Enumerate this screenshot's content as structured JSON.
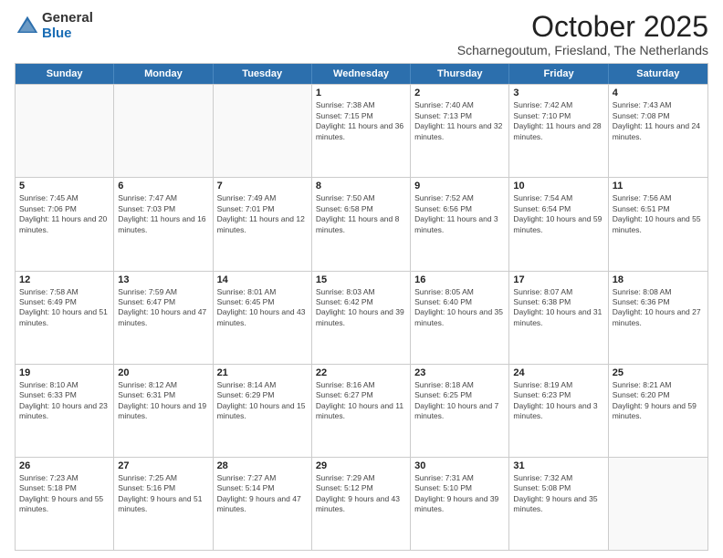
{
  "logo": {
    "general": "General",
    "blue": "Blue"
  },
  "title": "October 2025",
  "subtitle": "Scharnegoutum, Friesland, The Netherlands",
  "weekdays": [
    "Sunday",
    "Monday",
    "Tuesday",
    "Wednesday",
    "Thursday",
    "Friday",
    "Saturday"
  ],
  "weeks": [
    [
      {
        "day": "",
        "sunrise": "",
        "sunset": "",
        "daylight": ""
      },
      {
        "day": "",
        "sunrise": "",
        "sunset": "",
        "daylight": ""
      },
      {
        "day": "",
        "sunrise": "",
        "sunset": "",
        "daylight": ""
      },
      {
        "day": "1",
        "sunrise": "Sunrise: 7:38 AM",
        "sunset": "Sunset: 7:15 PM",
        "daylight": "Daylight: 11 hours and 36 minutes."
      },
      {
        "day": "2",
        "sunrise": "Sunrise: 7:40 AM",
        "sunset": "Sunset: 7:13 PM",
        "daylight": "Daylight: 11 hours and 32 minutes."
      },
      {
        "day": "3",
        "sunrise": "Sunrise: 7:42 AM",
        "sunset": "Sunset: 7:10 PM",
        "daylight": "Daylight: 11 hours and 28 minutes."
      },
      {
        "day": "4",
        "sunrise": "Sunrise: 7:43 AM",
        "sunset": "Sunset: 7:08 PM",
        "daylight": "Daylight: 11 hours and 24 minutes."
      }
    ],
    [
      {
        "day": "5",
        "sunrise": "Sunrise: 7:45 AM",
        "sunset": "Sunset: 7:06 PM",
        "daylight": "Daylight: 11 hours and 20 minutes."
      },
      {
        "day": "6",
        "sunrise": "Sunrise: 7:47 AM",
        "sunset": "Sunset: 7:03 PM",
        "daylight": "Daylight: 11 hours and 16 minutes."
      },
      {
        "day": "7",
        "sunrise": "Sunrise: 7:49 AM",
        "sunset": "Sunset: 7:01 PM",
        "daylight": "Daylight: 11 hours and 12 minutes."
      },
      {
        "day": "8",
        "sunrise": "Sunrise: 7:50 AM",
        "sunset": "Sunset: 6:58 PM",
        "daylight": "Daylight: 11 hours and 8 minutes."
      },
      {
        "day": "9",
        "sunrise": "Sunrise: 7:52 AM",
        "sunset": "Sunset: 6:56 PM",
        "daylight": "Daylight: 11 hours and 3 minutes."
      },
      {
        "day": "10",
        "sunrise": "Sunrise: 7:54 AM",
        "sunset": "Sunset: 6:54 PM",
        "daylight": "Daylight: 10 hours and 59 minutes."
      },
      {
        "day": "11",
        "sunrise": "Sunrise: 7:56 AM",
        "sunset": "Sunset: 6:51 PM",
        "daylight": "Daylight: 10 hours and 55 minutes."
      }
    ],
    [
      {
        "day": "12",
        "sunrise": "Sunrise: 7:58 AM",
        "sunset": "Sunset: 6:49 PM",
        "daylight": "Daylight: 10 hours and 51 minutes."
      },
      {
        "day": "13",
        "sunrise": "Sunrise: 7:59 AM",
        "sunset": "Sunset: 6:47 PM",
        "daylight": "Daylight: 10 hours and 47 minutes."
      },
      {
        "day": "14",
        "sunrise": "Sunrise: 8:01 AM",
        "sunset": "Sunset: 6:45 PM",
        "daylight": "Daylight: 10 hours and 43 minutes."
      },
      {
        "day": "15",
        "sunrise": "Sunrise: 8:03 AM",
        "sunset": "Sunset: 6:42 PM",
        "daylight": "Daylight: 10 hours and 39 minutes."
      },
      {
        "day": "16",
        "sunrise": "Sunrise: 8:05 AM",
        "sunset": "Sunset: 6:40 PM",
        "daylight": "Daylight: 10 hours and 35 minutes."
      },
      {
        "day": "17",
        "sunrise": "Sunrise: 8:07 AM",
        "sunset": "Sunset: 6:38 PM",
        "daylight": "Daylight: 10 hours and 31 minutes."
      },
      {
        "day": "18",
        "sunrise": "Sunrise: 8:08 AM",
        "sunset": "Sunset: 6:36 PM",
        "daylight": "Daylight: 10 hours and 27 minutes."
      }
    ],
    [
      {
        "day": "19",
        "sunrise": "Sunrise: 8:10 AM",
        "sunset": "Sunset: 6:33 PM",
        "daylight": "Daylight: 10 hours and 23 minutes."
      },
      {
        "day": "20",
        "sunrise": "Sunrise: 8:12 AM",
        "sunset": "Sunset: 6:31 PM",
        "daylight": "Daylight: 10 hours and 19 minutes."
      },
      {
        "day": "21",
        "sunrise": "Sunrise: 8:14 AM",
        "sunset": "Sunset: 6:29 PM",
        "daylight": "Daylight: 10 hours and 15 minutes."
      },
      {
        "day": "22",
        "sunrise": "Sunrise: 8:16 AM",
        "sunset": "Sunset: 6:27 PM",
        "daylight": "Daylight: 10 hours and 11 minutes."
      },
      {
        "day": "23",
        "sunrise": "Sunrise: 8:18 AM",
        "sunset": "Sunset: 6:25 PM",
        "daylight": "Daylight: 10 hours and 7 minutes."
      },
      {
        "day": "24",
        "sunrise": "Sunrise: 8:19 AM",
        "sunset": "Sunset: 6:23 PM",
        "daylight": "Daylight: 10 hours and 3 minutes."
      },
      {
        "day": "25",
        "sunrise": "Sunrise: 8:21 AM",
        "sunset": "Sunset: 6:20 PM",
        "daylight": "Daylight: 9 hours and 59 minutes."
      }
    ],
    [
      {
        "day": "26",
        "sunrise": "Sunrise: 7:23 AM",
        "sunset": "Sunset: 5:18 PM",
        "daylight": "Daylight: 9 hours and 55 minutes."
      },
      {
        "day": "27",
        "sunrise": "Sunrise: 7:25 AM",
        "sunset": "Sunset: 5:16 PM",
        "daylight": "Daylight: 9 hours and 51 minutes."
      },
      {
        "day": "28",
        "sunrise": "Sunrise: 7:27 AM",
        "sunset": "Sunset: 5:14 PM",
        "daylight": "Daylight: 9 hours and 47 minutes."
      },
      {
        "day": "29",
        "sunrise": "Sunrise: 7:29 AM",
        "sunset": "Sunset: 5:12 PM",
        "daylight": "Daylight: 9 hours and 43 minutes."
      },
      {
        "day": "30",
        "sunrise": "Sunrise: 7:31 AM",
        "sunset": "Sunset: 5:10 PM",
        "daylight": "Daylight: 9 hours and 39 minutes."
      },
      {
        "day": "31",
        "sunrise": "Sunrise: 7:32 AM",
        "sunset": "Sunset: 5:08 PM",
        "daylight": "Daylight: 9 hours and 35 minutes."
      },
      {
        "day": "",
        "sunrise": "",
        "sunset": "",
        "daylight": ""
      }
    ]
  ]
}
